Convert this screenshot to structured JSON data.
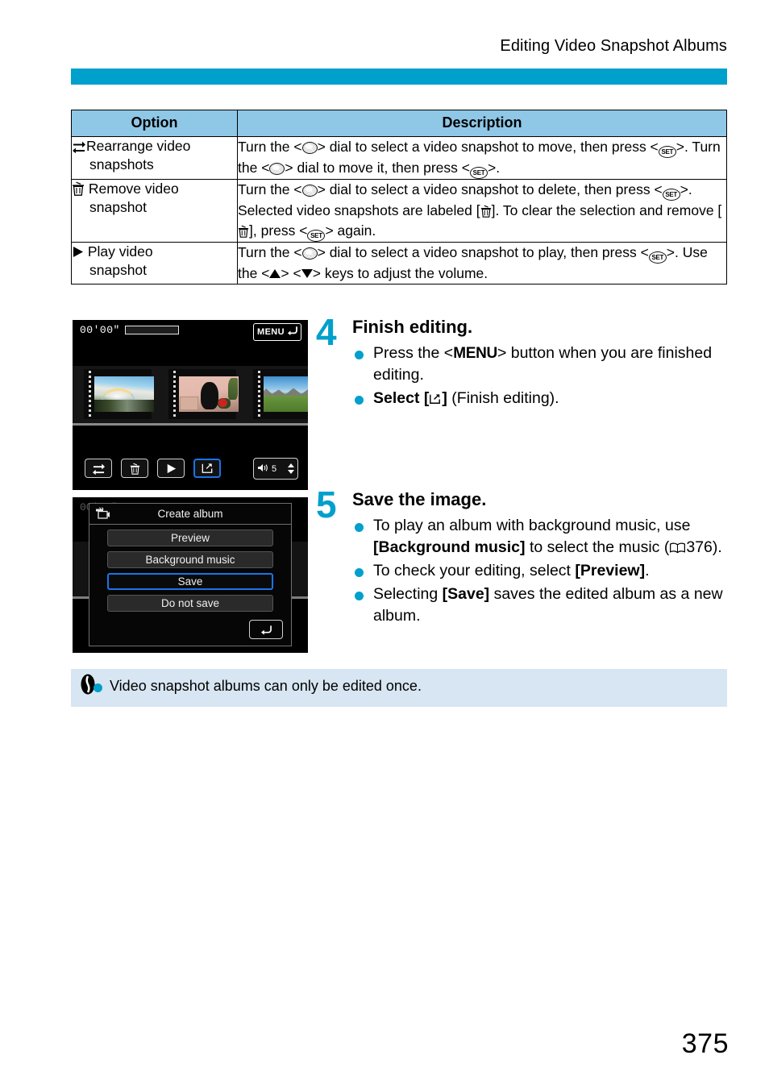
{
  "header": {
    "title": "Editing Video Snapshot Albums"
  },
  "table": {
    "columns": [
      "Option",
      "Description"
    ],
    "rows": [
      {
        "icon": "rearrange-icon",
        "option_line1": "Rearrange video",
        "option_line2": "snapshots",
        "description": "Turn the <DIAL> dial to select a video snapshot to move, then press <SET>. Turn the <DIAL> dial to move it, then press <SET>.",
        "desc_parts": [
          "Turn the <",
          "> dial to select a video snapshot to move, then press <",
          ">. Turn the <",
          "> dial to move it, then press <",
          ">."
        ]
      },
      {
        "icon": "trash-icon",
        "option_line1": "Remove video",
        "option_line2": "snapshot",
        "description": "Turn the <DIAL> dial to select a video snapshot to delete, then press <SET>. Selected video snapshots are labeled [TRASH]. To clear the selection and remove [TRASH], press <SET> again.",
        "desc_parts": [
          "Turn the <",
          "> dial to select a video snapshot to delete, then press <",
          ">. Selected video snapshots are labeled [",
          "]. To clear the selection and remove [",
          "], press <",
          "> again."
        ]
      },
      {
        "icon": "play-icon",
        "option_line1": "Play video",
        "option_line2": "snapshot",
        "description": "Turn the <DIAL> dial to select a video snapshot to play, then press <SET>. Use the <UP> <DOWN> keys to adjust the volume.",
        "desc_parts": [
          "Turn the <",
          "> dial to select a video snapshot to play, then press <",
          ">. Use the <",
          "> <",
          "> keys to adjust the volume."
        ]
      }
    ]
  },
  "screen_one": {
    "timecode": "00′00″",
    "menu_label": "MENU",
    "volume_value": "5",
    "thumbnails": [
      "waterfall-rainbow",
      "dog-indoor",
      "mountain-meadow"
    ],
    "toolbar_icons": [
      "rearrange-icon",
      "trash-icon",
      "play-icon",
      "finish-editing-icon"
    ],
    "selected_tool": "finish-editing-icon"
  },
  "screen_two": {
    "timecode": "00′00″",
    "dialog_title": "Create album",
    "items": [
      "Preview",
      "Background music",
      "Save",
      "Do not save"
    ],
    "selected_item": "Save",
    "back_icon": "return-arrow-icon"
  },
  "steps": [
    {
      "number": "4",
      "heading": "Finish editing.",
      "bullets": [
        {
          "pre": "Press the <",
          "glyph": "MENU",
          "post": "> button when you are finished editing."
        },
        {
          "pre": "Select [",
          "glyph": "finish-editing-icon",
          "post": "] (Finish editing)."
        }
      ]
    },
    {
      "number": "5",
      "heading": "Save the image.",
      "bullets": [
        {
          "pre": "To play an album with background music, use ",
          "bold": "[Background music]",
          "mid": " to select the music (",
          "page_ref": "376",
          "post": ")."
        },
        {
          "pre": "To check your editing, select ",
          "bold": "[Preview]",
          "post": "."
        },
        {
          "pre": "Selecting ",
          "bold": "[Save]",
          "post": " saves the edited album as a new album."
        }
      ]
    }
  ],
  "note": {
    "icon": "caution-icon",
    "text": "Video snapshot albums can only be edited once."
  },
  "page_number": "375",
  "colors": {
    "accent": "#00A0CC",
    "table_header": "#8FC7E6",
    "note_bg": "#D7E6F2",
    "selection_blue": "#1A74E8"
  }
}
